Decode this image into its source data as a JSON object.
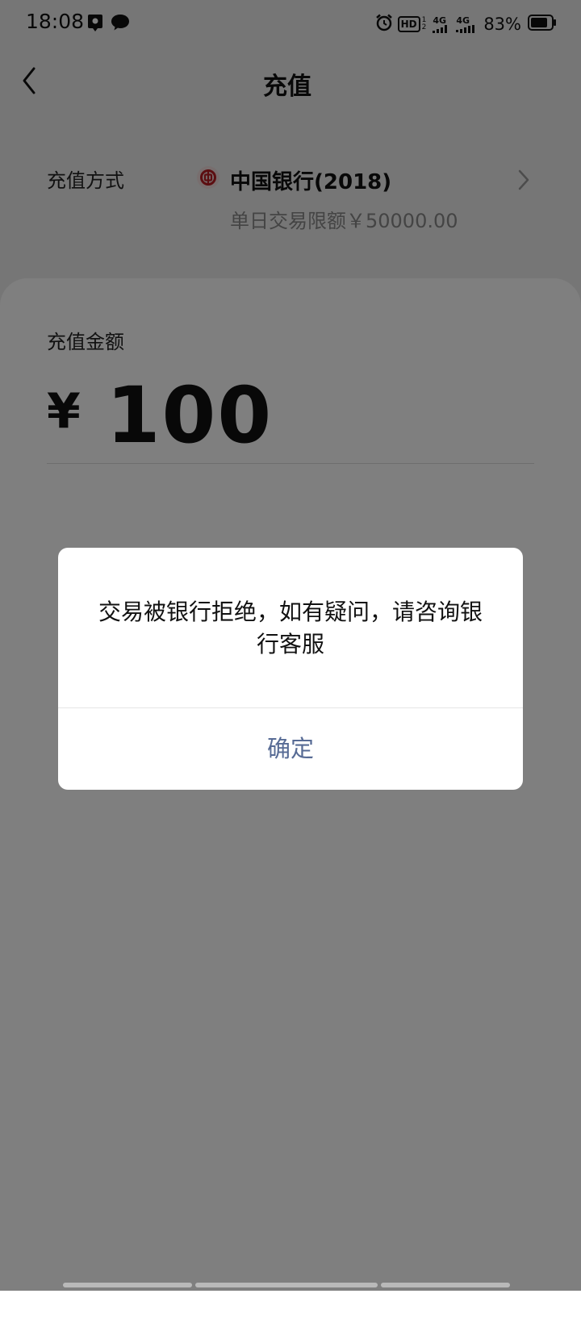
{
  "status_bar": {
    "time": "18:08",
    "battery_percent": "83%",
    "battery_level": 0.83,
    "hd_tag": "HD",
    "net1": "4G",
    "net2": "4G",
    "icons": [
      "location-icon",
      "chat-icon",
      "alarm-icon",
      "hd-icon",
      "signal-icon",
      "signal-icon",
      "battery-icon"
    ]
  },
  "nav": {
    "title": "充值",
    "back_icon": "chevron-left-icon"
  },
  "payment_method": {
    "label": "充值方式",
    "bank_name": "中国银行(2018)",
    "daily_limit": "单日交易限额￥50000.00",
    "logo_icon": "bank-of-china-icon",
    "logo_color": "#b81c22"
  },
  "amount": {
    "label": "充值金额",
    "currency": "¥",
    "value": "100"
  },
  "dialog": {
    "message": "交易被银行拒绝，如有疑问，请咨询银行客服",
    "confirm_label": "确定",
    "confirm_color": "#576b95"
  }
}
